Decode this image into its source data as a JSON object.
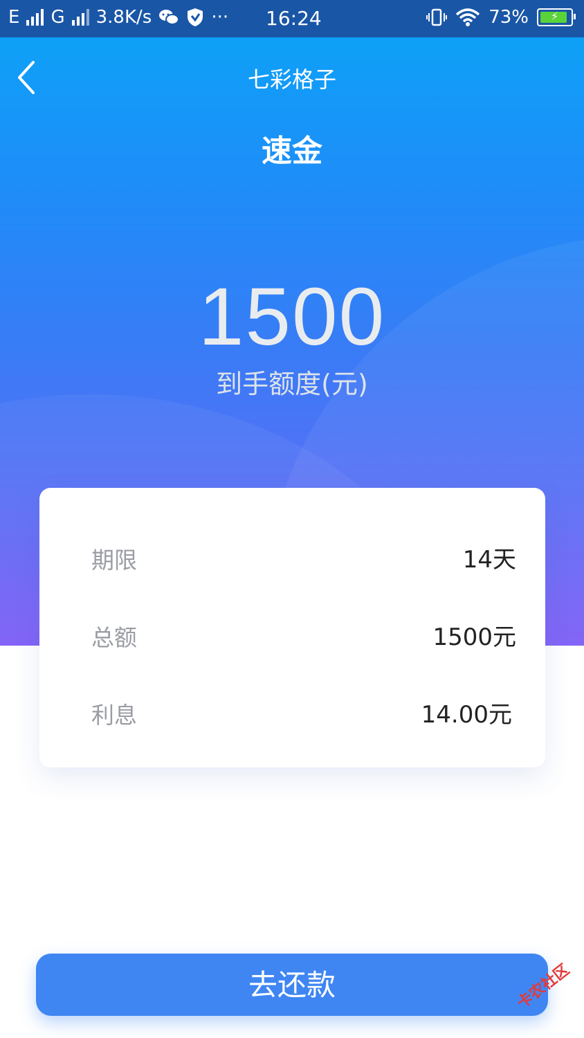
{
  "status_bar": {
    "carrier1": "E",
    "carrier2": "G",
    "speed": "3.8K/s",
    "more": "···",
    "time": "16:24",
    "battery": "73%",
    "battery_color": "#5ad33a"
  },
  "nav": {
    "back_icon": "chevron-left",
    "title": "七彩格子"
  },
  "hero": {
    "product_name": "速金",
    "amount": "1500",
    "amount_label": "到手额度(元)"
  },
  "details": [
    {
      "label": "期限",
      "value": "14天"
    },
    {
      "label": "总额",
      "value": "1500元"
    },
    {
      "label": "利息",
      "value": "14.00元"
    }
  ],
  "actions": {
    "repay_label": "去还款",
    "accent": "#3f86f3"
  },
  "watermark": "卡农社区"
}
